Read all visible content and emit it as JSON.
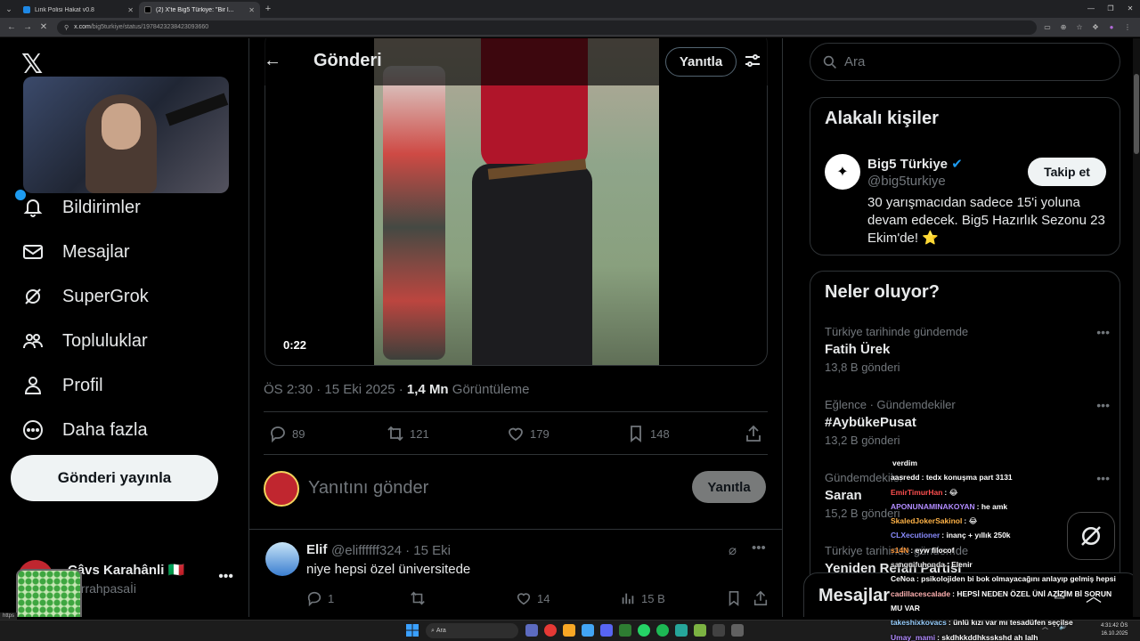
{
  "browser": {
    "tabs": [
      {
        "title": "Link Polisi Hakat v0.8"
      },
      {
        "title": "(2) X'te Big5 Türkiye: \"Bir l..."
      }
    ],
    "url_host": "x.com",
    "url_path": "/big5turkiye/status/1978423238423093660"
  },
  "leftnav": {
    "items": [
      {
        "label": "Bildirimler",
        "icon": "bell-icon"
      },
      {
        "label": "Mesajlar",
        "icon": "mail-icon"
      },
      {
        "label": "SuperGrok",
        "icon": "grok-icon"
      },
      {
        "label": "Topluluklar",
        "icon": "people-icon"
      },
      {
        "label": "Profil",
        "icon": "person-icon"
      },
      {
        "label": "Daha fazla",
        "icon": "more-circle-icon"
      }
    ],
    "post_button": "Gönderi yayınla",
    "account": {
      "name": "Câvs Karahânli 🇮🇹",
      "handle": "cerrahpasaİi"
    }
  },
  "header": {
    "title": "Gönderi",
    "reply_button": "Yanıtla"
  },
  "post": {
    "video_time": "0:22",
    "timestamp": "ÖS 2:30 · 15 Eki 2025 · ",
    "views_count": "1,4 Mn",
    "views_label": " Görüntüleme",
    "replies": "89",
    "reposts": "121",
    "likes": "179",
    "bookmarks": "148"
  },
  "compose": {
    "placeholder": "Yanıtını gönder",
    "button": "Yanıtla"
  },
  "reply": {
    "name": "Elif",
    "handle": "@eliffffff324 · 15 Eki",
    "text": "niye hepsi özel üniversitede",
    "replies": "1",
    "likes": "14",
    "views": "15 B"
  },
  "right": {
    "search_placeholder": "Ara",
    "related_title": "Alakalı kişiler",
    "related": {
      "name": "Big5 Türkiye",
      "handle": "@big5turkiye",
      "follow": "Takip et",
      "bio": "30 yarışmacıdan sadece 15'i yoluna devam edecek. Big5 Hazırlık Sezonu 23 Ekim'de! ⭐"
    },
    "trends_title": "Neler oluyor?",
    "trends": [
      {
        "context": "Türkiye tarihinde gündemde",
        "title": "Fatih Ürek",
        "count": "13,8 B gönderi"
      },
      {
        "context": "Eğlence · Gündemdekiler",
        "title": "#AybükePusat",
        "count": "13,2 B gönderi"
      },
      {
        "context": "Gündemdekiler",
        "title": "Saran",
        "count": "15,2 B gönderi"
      },
      {
        "context": "Türkiye tarihinde gündemde",
        "title": "Yeniden Refah Partisi",
        "count": ""
      }
    ],
    "messages_drawer": "Mesajlar"
  },
  "chat": [
    {
      "user": "",
      "msg": "verdim",
      "color": "#ffffff"
    },
    {
      "user": "aasredd",
      "msg": "tedx konuşma part 3131",
      "color": "#ffffff"
    },
    {
      "user": "EmirTimurHan",
      "msg": "😂",
      "color": "#ff4f4f"
    },
    {
      "user": "APONUNAMINAKOYAN",
      "msg": "he amk",
      "color": "#b28cff"
    },
    {
      "user": "SkaledJokerSakinol",
      "msg": "😂",
      "color": "#ffb347"
    },
    {
      "user": "CLXecutioner",
      "msg": "inanç + yıllık 250k",
      "color": "#8a8cff"
    },
    {
      "user": "s14N",
      "msg": "eyw filocof",
      "color": "#ff9a3d"
    },
    {
      "user": "sanguifuhonda",
      "msg": "Elenir",
      "color": "#dddddd"
    },
    {
      "user": "CeNoa",
      "msg": "psikolojiden bi bok olmayacağını anlayıp gelmiş hepsi",
      "color": "#ffffff"
    },
    {
      "user": "cadillacescalade",
      "msg": "HEPSİ NEDEN ÖZEL ÜNİ AZİZİM Bİ SORUN",
      "color": "#ffb0b0"
    },
    {
      "user": "",
      "msg": "MU VAR",
      "color": "#ffffff"
    },
    {
      "user": "takeshixkovacs",
      "msg": "ünlü kızı var mı tesadüfen seçilse",
      "color": "#9ad0ff"
    },
    {
      "user": "Umay_mami",
      "msg": "skdhkkddhksskshd ah lalh",
      "color": "#b28cff"
    }
  ],
  "taskbar": {
    "search": "Ara",
    "time": "4:31:42 ÖS",
    "date": "16.10.2025"
  },
  "status_link": "https"
}
